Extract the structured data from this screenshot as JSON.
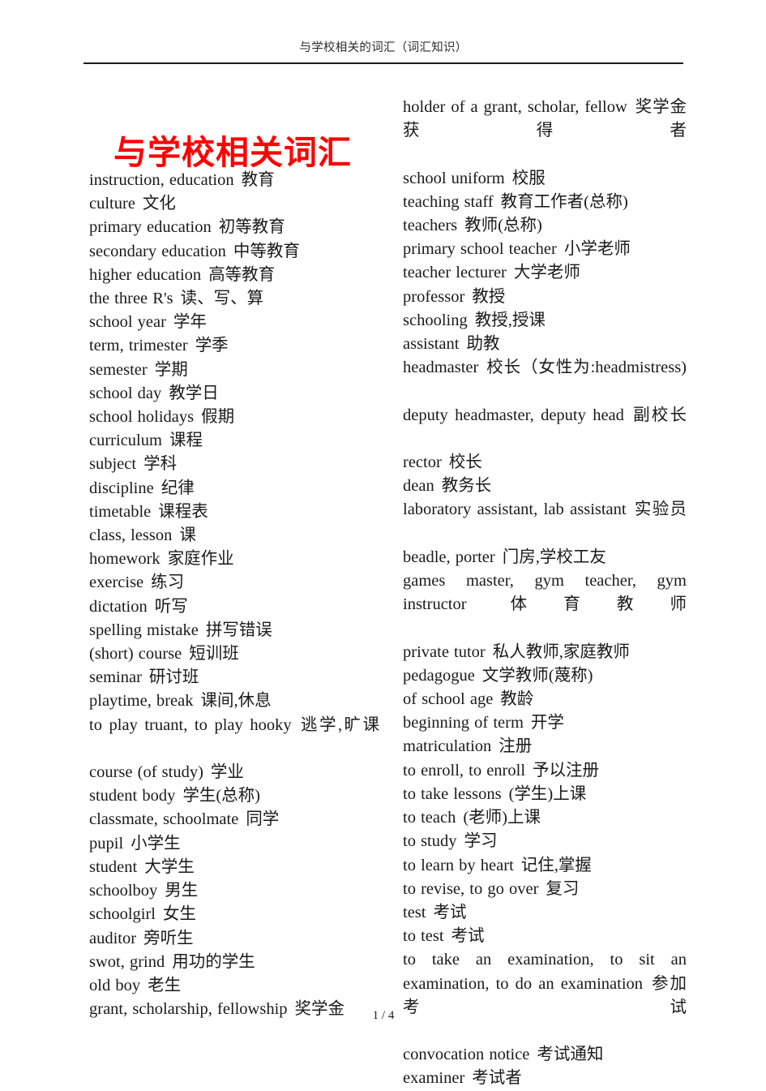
{
  "header": {
    "running_title": "与学校相关的词汇（词汇知识）"
  },
  "title": "与学校相关词汇",
  "title_color": "#ff0000",
  "footer": {
    "page_number": "1 / 4"
  },
  "columns": {
    "left": [
      {
        "en": "instruction, education",
        "cn": "教育",
        "wrap": false
      },
      {
        "en": "culture",
        "cn": "文化",
        "wrap": false
      },
      {
        "en": "primary education",
        "cn": "初等教育",
        "wrap": false
      },
      {
        "en": "secondary education",
        "cn": "中等教育",
        "wrap": false
      },
      {
        "en": "higher education",
        "cn": "高等教育",
        "wrap": false
      },
      {
        "en": "the three R's",
        "cn": "读、写、算",
        "wrap": false
      },
      {
        "en": "school year",
        "cn": "学年",
        "wrap": false
      },
      {
        "en": "term, trimester",
        "cn": "学季",
        "wrap": false
      },
      {
        "en": "semester",
        "cn": "学期",
        "wrap": false
      },
      {
        "en": "school day",
        "cn": "教学日",
        "wrap": false
      },
      {
        "en": "school holidays",
        "cn": "假期",
        "wrap": false
      },
      {
        "en": "curriculum",
        "cn": "课程",
        "wrap": false
      },
      {
        "en": "subject",
        "cn": "学科",
        "wrap": false
      },
      {
        "en": "discipline",
        "cn": "纪律",
        "wrap": false
      },
      {
        "en": "timetable",
        "cn": "课程表",
        "wrap": false
      },
      {
        "en": "class, lesson",
        "cn": "课",
        "wrap": false
      },
      {
        "en": "homework",
        "cn": "家庭作业",
        "wrap": false
      },
      {
        "en": "exercise",
        "cn": "练习",
        "wrap": false
      },
      {
        "en": "dictation",
        "cn": "听写",
        "wrap": false
      },
      {
        "en": "spelling mistake",
        "cn": "拼写错误",
        "wrap": false
      },
      {
        "en": "(short) course",
        "cn": "短训班",
        "wrap": false
      },
      {
        "en": "seminar",
        "cn": "研讨班",
        "wrap": false
      },
      {
        "en": "playtime, break",
        "cn": "课间,休息",
        "wrap": false
      },
      {
        "en": "to play truant, to play hooky",
        "cn": "逃学,旷课",
        "wrap": true
      },
      {
        "en": "course (of study)",
        "cn": "学业",
        "wrap": false
      },
      {
        "en": "student body",
        "cn": "学生(总称)",
        "wrap": false
      },
      {
        "en": "classmate, schoolmate",
        "cn": "同学",
        "wrap": false
      },
      {
        "en": "pupil",
        "cn": "小学生",
        "wrap": false
      },
      {
        "en": "student",
        "cn": "大学生",
        "wrap": false
      },
      {
        "en": "schoolboy",
        "cn": "男生",
        "wrap": false
      },
      {
        "en": "schoolgirl",
        "cn": "女生",
        "wrap": false
      },
      {
        "en": "auditor",
        "cn": "旁听生",
        "wrap": false
      },
      {
        "en": "swot, grind",
        "cn": "用功的学生",
        "wrap": false
      },
      {
        "en": "old boy",
        "cn": "老生",
        "wrap": false
      },
      {
        "en": "grant, scholarship, fellowship",
        "cn": "奖学金",
        "wrap": false
      }
    ],
    "right": [
      {
        "en": "holder of a grant, scholar, fellow",
        "cn": "奖学金获得者",
        "wrap": true
      },
      {
        "en": "school uniform",
        "cn": "校服",
        "wrap": false
      },
      {
        "en": "teaching staff",
        "cn": "教育工作者(总称)",
        "wrap": false
      },
      {
        "en": "teachers",
        "cn": "教师(总称)",
        "wrap": false
      },
      {
        "en": "primary school teacher",
        "cn": "小学老师",
        "wrap": false
      },
      {
        "en": "teacher lecturer",
        "cn": "大学老师",
        "wrap": false
      },
      {
        "en": "professor",
        "cn": "教授",
        "wrap": false
      },
      {
        "en": "schooling",
        "cn": "教授,授课",
        "wrap": false
      },
      {
        "en": "assistant",
        "cn": "助教",
        "wrap": false
      },
      {
        "en": "headmaster",
        "cn": "校长（女性为:headmistress)",
        "wrap": true
      },
      {
        "en": "deputy headmaster, deputy head",
        "cn": "副校长",
        "wrap": true
      },
      {
        "en": "rector",
        "cn": "校长",
        "wrap": false
      },
      {
        "en": "dean",
        "cn": "教务长",
        "wrap": false
      },
      {
        "en": "laboratory assistant, lab assistant",
        "cn": "实验员",
        "wrap": true
      },
      {
        "en": "beadle, porter",
        "cn": "门房,学校工友",
        "wrap": false
      },
      {
        "en": "games master, gym teacher, gym instructor",
        "cn": "体育教师",
        "wrap": true
      },
      {
        "en": "private tutor",
        "cn": "私人教师,家庭教师",
        "wrap": false
      },
      {
        "en": "pedagogue",
        "cn": "文学教师(蔑称)",
        "wrap": false
      },
      {
        "en": "of school age",
        "cn": "教龄",
        "wrap": false
      },
      {
        "en": "beginning of term",
        "cn": "开学",
        "wrap": false
      },
      {
        "en": "matriculation",
        "cn": "注册",
        "wrap": false
      },
      {
        "en": "to enroll, to enroll",
        "cn": "予以注册",
        "wrap": false
      },
      {
        "en": "to take lessons",
        "cn": "(学生)上课",
        "wrap": false
      },
      {
        "en": "to teach",
        "cn": "(老师)上课",
        "wrap": false
      },
      {
        "en": "to study",
        "cn": "学习",
        "wrap": false
      },
      {
        "en": "to learn by heart",
        "cn": "记住,掌握",
        "wrap": false
      },
      {
        "en": "to revise, to go over",
        "cn": "复习",
        "wrap": false
      },
      {
        "en": "test",
        "cn": "考试",
        "wrap": false
      },
      {
        "en": "to test",
        "cn": "考试",
        "wrap": false
      },
      {
        "en": "to take an examination, to sit an examination, to do an examination",
        "cn": "参加考试",
        "wrap": true
      },
      {
        "en": "convocation notice",
        "cn": "考试通知",
        "wrap": false
      },
      {
        "en": "examiner",
        "cn": "考试者",
        "wrap": false
      }
    ]
  }
}
